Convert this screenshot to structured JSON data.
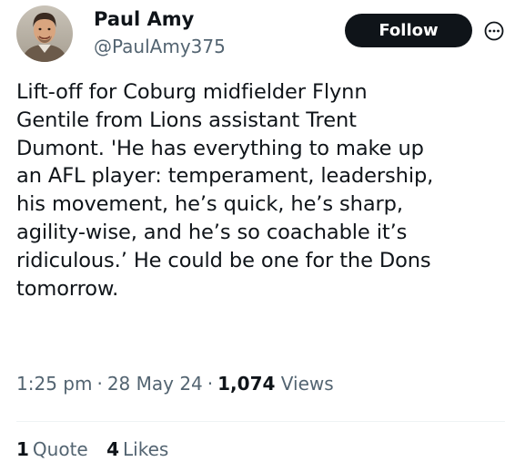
{
  "author": {
    "display_name": "Paul Amy",
    "handle": "@PaulAmy375",
    "avatar_icon": "profile-photo"
  },
  "actions": {
    "follow_label": "Follow",
    "more_icon": "more-circle-icon"
  },
  "tweet": {
    "lines": [
      "Lift-off for Coburg midfielder Flynn",
      "Gentile from Lions assistant Trent",
      "Dumont. 'He has everything to make up",
      "an AFL player: temperament, leadership,",
      "his movement, he’s quick, he’s sharp,",
      "agility-wise, and he’s so coachable it’s",
      "ridiculous.’ He could be one for the Dons",
      "tomorrow."
    ]
  },
  "meta": {
    "time": "1:25 pm",
    "date": "28 May 24",
    "views_count": "1,074",
    "views_label": "Views"
  },
  "stats": {
    "quotes_count": "1",
    "quotes_label": "Quote",
    "likes_count": "4",
    "likes_label": "Likes"
  },
  "colors": {
    "text_primary": "#0f1419",
    "text_secondary": "#536471",
    "follow_button_bg": "#0f1419",
    "divider": "#eff3f4"
  }
}
